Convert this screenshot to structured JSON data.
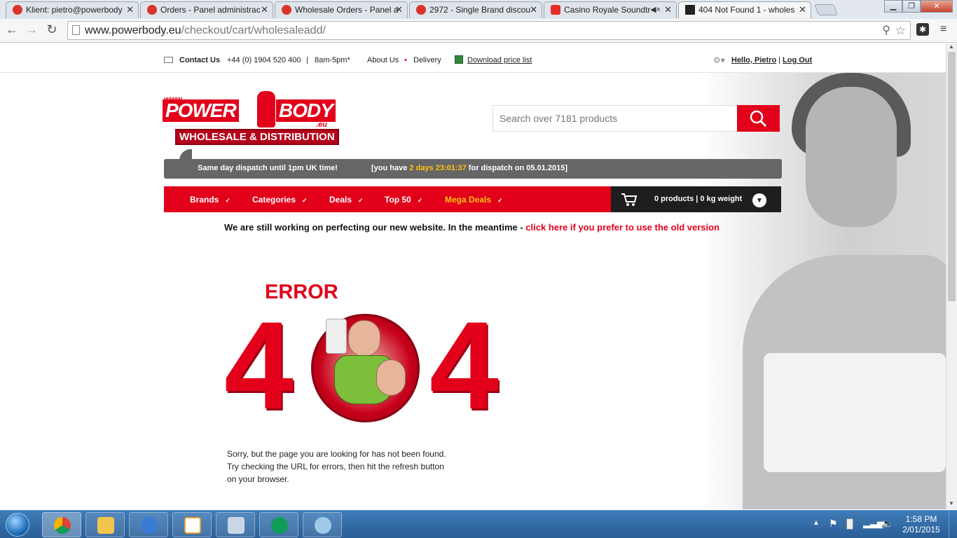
{
  "browser": {
    "tabs": [
      {
        "title": "Klient: pietro@powerbody",
        "icon": "magento-icon"
      },
      {
        "title": "Orders - Panel administrac",
        "icon": "magento-icon"
      },
      {
        "title": "Wholesale Orders - Panel a",
        "icon": "magento-icon"
      },
      {
        "title": "2972 - Single Brand discou",
        "icon": "magento-icon"
      },
      {
        "title": "Casino Royale Soundtr",
        "icon": "youtube-icon",
        "mute": "◀×"
      },
      {
        "title": "404 Not Found 1 - wholes",
        "icon": "powerbody-icon",
        "active": true
      }
    ],
    "url_domain": "www.powerbody.eu",
    "url_path": "/checkout/cart/wholesaleadd/"
  },
  "topbar": {
    "contact_label": "Contact Us",
    "phone": "+44 (0) 1904 520 400",
    "separator": "|",
    "hours": "8am-5pm*",
    "about": "About Us",
    "delivery": "Delivery",
    "download": "Download price list",
    "greeting": "Hello, Pietro",
    "divider": "|",
    "logout": "Log Out"
  },
  "logo": {
    "www": "www.",
    "power": "POWER",
    "body": "BODY",
    "eu": ".eu",
    "tagline": "WHOLESALE & DISTRIBUTION"
  },
  "search": {
    "placeholder": "Search over 7181 products"
  },
  "dispatch": {
    "left": "Same day dispatch until 1pm UK time!",
    "prefix": "[you have ",
    "countdown": "2 days 23:01:37",
    "suffix": " for dispatch on 05.01.2015]"
  },
  "nav": {
    "items": [
      "Brands",
      "Categories",
      "Deals",
      "Top 50",
      "Mega Deals"
    ],
    "cart_summary": "0 products | 0 kg weight"
  },
  "notice": {
    "text": "We are still working on perfecting our new website. In the meantime - ",
    "link": "click here if you prefer to use the old version"
  },
  "error": {
    "title": "ERROR",
    "digit_left": "4",
    "digit_right": "4",
    "line1": "Sorry, but the page you are looking for has not been found.",
    "line2": "Try checking the URL for errors, then hit the refresh button",
    "line3": "on your browser."
  },
  "taskbar": {
    "time": "1:58 PM",
    "date": "2/01/2015",
    "apps": [
      "chrome-icon",
      "explorer-icon",
      "thunderbird-icon",
      "grid-app-icon",
      "calculator-icon",
      "hangouts-icon",
      "paint-icon"
    ]
  },
  "colors": {
    "brand_red": "#e2001a",
    "dark_bar": "#666666",
    "countdown": "#ffc20e",
    "mega_deals": "#ffc20e"
  }
}
